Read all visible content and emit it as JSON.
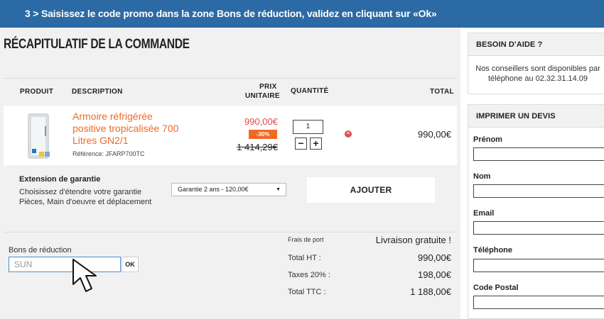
{
  "banner": {
    "text": "3 > Saisissez le code promo dans la zone Bons de réduction, validez en cliquant sur «Ok»"
  },
  "page": {
    "title": "RÉCAPITULATIF DE LA COMMANDE"
  },
  "table": {
    "headers": {
      "product": "PRODUIT",
      "description": "DESCRIPTION",
      "unit_price": [
        "PRIX",
        "UNITAIRE"
      ],
      "quantity": "QUANTITÉ",
      "total": "TOTAL"
    }
  },
  "item": {
    "name": "Armoire réfrigérée positive tropicalisée 700 Litres GN2/1",
    "reference": "Référence: JFARP700TC",
    "price_new": "990,00€",
    "discount": "-30%",
    "price_old": "1 414,29€",
    "quantity": "1",
    "minus": "−",
    "plus": "+",
    "remove": "×",
    "total": "990,00€"
  },
  "warranty": {
    "title": "Extension de garantie",
    "description": "Choisissez d'étendre votre garantie Pièces, Main d'oeuvre et déplacement",
    "selected": "Garantie 2 ans - 120,00€",
    "caret": "▼",
    "add_label": "AJOUTER"
  },
  "coupon": {
    "label": "Bons de réduction",
    "value": "SUN",
    "ok_label": "OK"
  },
  "summary": {
    "shipping_label": "Frais de port",
    "shipping_value": "Livraison gratuite !",
    "ht_label": "Total HT :",
    "ht_value": "990,00€",
    "tax_label": "Taxes 20% :",
    "tax_value": "198,00€",
    "ttc_label": "Total TTC :",
    "ttc_value": "1 188,00€"
  },
  "help": {
    "title": "BESOIN D'AIDE ?",
    "text": "Nos conseillers sont disponibles par téléphone au 02.32.31.14.09"
  },
  "quote": {
    "title": "IMPRIMER UN DEVIS",
    "fields": [
      "Prénom",
      "Nom",
      "Email",
      "Téléphone",
      "Code Postal"
    ]
  },
  "colors": {
    "banner": "#2b6aa5",
    "accent": "#ef6a25",
    "price": "#e24848",
    "background": "#f1f1f1"
  },
  "icons": {
    "product_image": "refrigerator-icon",
    "remove": "remove-icon",
    "cursor": "arrow-cursor-icon",
    "caret": "chevron-down-icon"
  }
}
